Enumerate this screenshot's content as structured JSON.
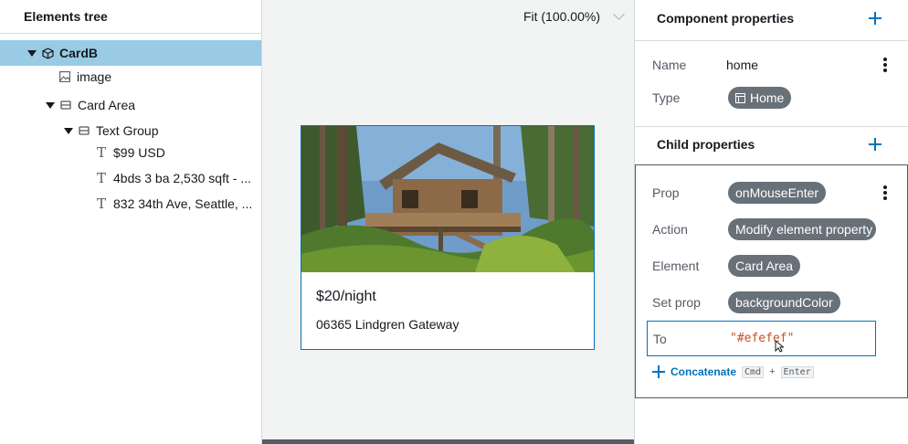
{
  "elements_tree": {
    "title": "Elements tree",
    "items": [
      {
        "label": "CardB",
        "icon": "component-icon",
        "selected": true
      },
      {
        "label": "image",
        "icon": "image-icon"
      },
      {
        "label": "Card Area",
        "icon": "flex-icon"
      },
      {
        "label": "Text Group",
        "icon": "flex-icon"
      },
      {
        "label": "$99 USD",
        "icon": "text-icon"
      },
      {
        "label": "4bds 3 ba 2,530 sqft - ...",
        "icon": "text-icon"
      },
      {
        "label": "832 34th Ave, Seattle, ...",
        "icon": "text-icon"
      }
    ]
  },
  "canvas": {
    "zoom_label": "Fit (100.00%)",
    "card": {
      "price": "$20/night",
      "address": "06365 Lindgren Gateway"
    }
  },
  "component_properties": {
    "title": "Component properties",
    "name_label": "Name",
    "name_value": "home",
    "type_label": "Type",
    "type_value": "Home"
  },
  "child_properties": {
    "title": "Child properties",
    "prop_label": "Prop",
    "prop_value": "onMouseEnter",
    "action_label": "Action",
    "action_value": "Modify element property",
    "element_label": "Element",
    "element_value": "Card Area",
    "set_prop_label": "Set prop",
    "set_prop_value": "backgroundColor",
    "to_label": "To",
    "to_value": "\"#efefef\"",
    "concatenate_label": "Concatenate",
    "shortcut_key1": "Cmd",
    "shortcut_plus": "+",
    "shortcut_key2": "Enter"
  },
  "colors": {
    "accent": "#0073bb",
    "selected_row": "#99cbe4",
    "pill": "#687078",
    "code_value": "#c7511f"
  }
}
